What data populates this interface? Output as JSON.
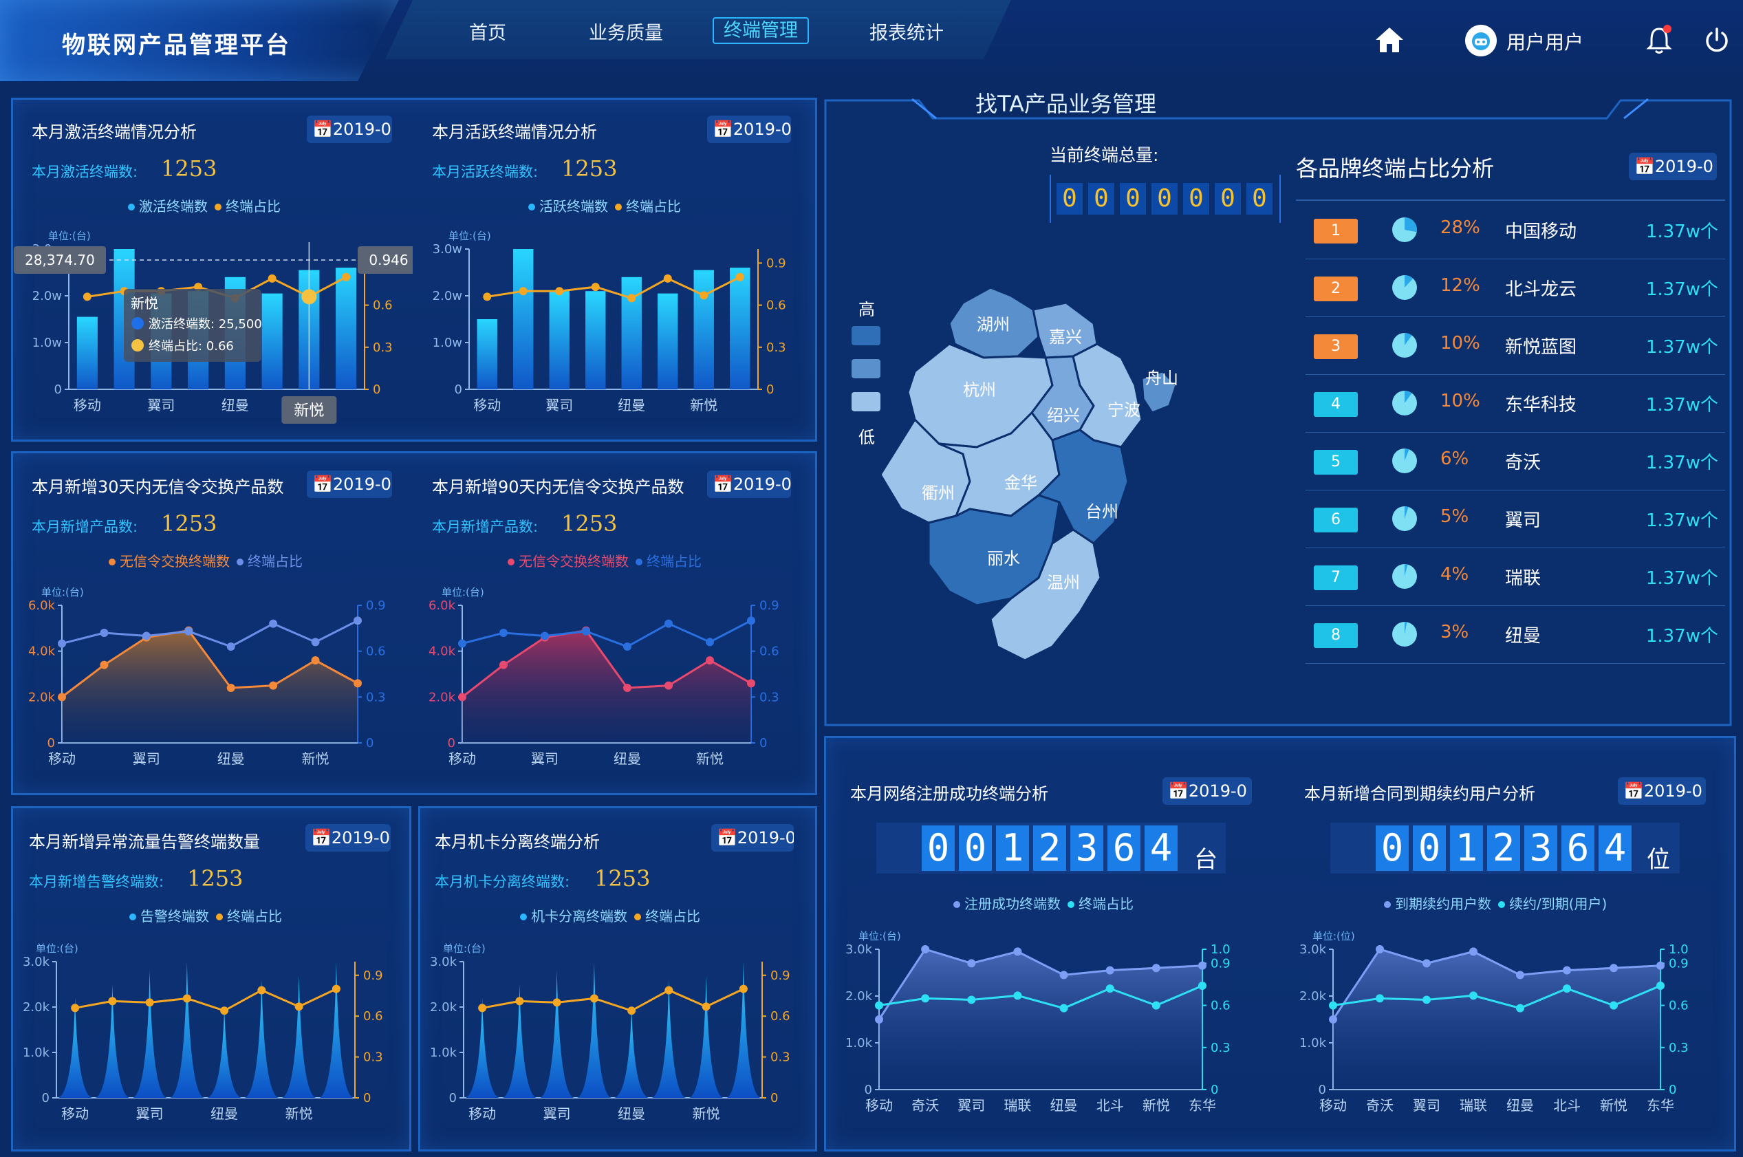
{
  "app": {
    "title": "物联网产品管理平台"
  },
  "nav": {
    "items": [
      "首页",
      "业务质量",
      "终端管理",
      "报表统计"
    ],
    "active": "终端管理"
  },
  "user": {
    "name": "用户用户"
  },
  "colors": {
    "bg": "#0a2a66",
    "panel": "#0c3276",
    "accent": "#2ab7ff",
    "orange": "#f5a623",
    "cyan": "#2ee0f4",
    "pink": "#e8496e"
  },
  "panel1": {
    "title": "本月激活终端情况分析",
    "date": "2019-0",
    "stat_label": "本月激活终端数:",
    "stat_value": "1253",
    "legend": [
      "激活终端数",
      "终端占比"
    ],
    "unit": "单位:(台)",
    "tooltip": {
      "name": "新悦",
      "bar_label": "激活终端数: 25,500",
      "line_label": "终端占比: 0.66",
      "left_value": "28,374.70",
      "right_value": "0.946",
      "axis_value": "新悦"
    }
  },
  "panel2": {
    "title": "本月活跃终端情况分析",
    "date": "2019-0",
    "stat_label": "本月活跃终端数:",
    "stat_value": "1253",
    "legend": [
      "活跃终端数",
      "终端占比"
    ],
    "unit": "单位:(台)"
  },
  "panel3": {
    "title": "本月新增30天内无信令交换产品数",
    "date": "2019-0",
    "stat_label": "本月新增产品数:",
    "stat_value": "1253",
    "legend": [
      "无信令交换终端数",
      "终端占比"
    ],
    "unit": "单位:(台)"
  },
  "panel4": {
    "title": "本月新增90天内无信令交换产品数",
    "date": "2019-0",
    "stat_label": "本月新增产品数:",
    "stat_value": "1253",
    "legend": [
      "无信令交换终端数",
      "终端占比"
    ],
    "unit": "单位:(台)"
  },
  "panel5": {
    "title": "本月新增异常流量告警终端数量",
    "date": "2019-0",
    "stat_label": "本月新增告警终端数:",
    "stat_value": "1253",
    "legend": [
      "告警终端数",
      "终端占比"
    ],
    "unit": "单位:(台)"
  },
  "panel6": {
    "title": "本月机卡分离终端分析",
    "date": "2019-0",
    "stat_label": "本月机卡分离终端数:",
    "stat_value": "1253",
    "legend": [
      "机卡分离终端数",
      "终端占比"
    ],
    "unit": "单位:(台)"
  },
  "center": {
    "title": "找TA产品业务管理",
    "total_label": "当前终端总量:",
    "total_digits": [
      "0",
      "0",
      "0",
      "0",
      "0",
      "0",
      "0"
    ],
    "map_legend": {
      "high": "高",
      "low": "低"
    },
    "cities": [
      "湖州",
      "嘉兴",
      "杭州",
      "舟山",
      "绍兴",
      "宁波",
      "衢州",
      "金华",
      "台州",
      "丽水",
      "温州"
    ]
  },
  "brand": {
    "title": "各品牌终端占比分析",
    "date": "2019-0",
    "rows": [
      {
        "rank": "1",
        "pct": "28%",
        "pct_value": 28,
        "name": "中国移动",
        "count": "1.37w个"
      },
      {
        "rank": "2",
        "pct": "12%",
        "pct_value": 12,
        "name": "北斗龙云",
        "count": "1.37w个"
      },
      {
        "rank": "3",
        "pct": "10%",
        "pct_value": 10,
        "name": "新悦蓝图",
        "count": "1.37w个"
      },
      {
        "rank": "4",
        "pct": "10%",
        "pct_value": 10,
        "name": "东华科技",
        "count": "1.37w个"
      },
      {
        "rank": "5",
        "pct": "6%",
        "pct_value": 6,
        "name": "奇沃",
        "count": "1.37w个"
      },
      {
        "rank": "6",
        "pct": "5%",
        "pct_value": 5,
        "name": "翼司",
        "count": "1.37w个"
      },
      {
        "rank": "7",
        "pct": "4%",
        "pct_value": 4,
        "name": "瑞联",
        "count": "1.37w个"
      },
      {
        "rank": "8",
        "pct": "3%",
        "pct_value": 3,
        "name": "纽曼",
        "count": "1.37w个"
      }
    ]
  },
  "panel7": {
    "title": "本月网络注册成功终端分析",
    "date": "2019-0",
    "digits": [
      "0",
      "0",
      "1",
      "2",
      "3",
      "6",
      "4"
    ],
    "digit_unit": "台",
    "legend": [
      "注册成功终端数",
      "终端占比"
    ],
    "unit": "单位:(台)"
  },
  "panel8": {
    "title": "本月新增合同到期续约用户分析",
    "date": "2019-0",
    "digits": [
      "0",
      "0",
      "1",
      "2",
      "3",
      "6",
      "4"
    ],
    "digit_unit": "位",
    "legend": [
      "到期续约用户数",
      "续约/到期(用户)"
    ],
    "unit": "单位:(位)"
  },
  "chart_data": [
    {
      "id": "c1",
      "type": "bar",
      "categories": [
        "移动",
        "",
        "翼司",
        "",
        "纽曼",
        "",
        "新悦",
        ""
      ],
      "series": [
        {
          "name": "激活终端数",
          "values": [
            15500,
            30000,
            20500,
            21000,
            24000,
            20500,
            25500,
            26000
          ]
        },
        {
          "name": "终端占比",
          "values": [
            0.66,
            0.7,
            0.7,
            0.73,
            0.65,
            0.79,
            0.66,
            0.8
          ]
        }
      ],
      "ylim": [
        0,
        30000
      ],
      "y2lim": [
        0,
        1.0
      ],
      "yticks": [
        "0",
        "1.0w",
        "2.0w",
        "3.0w"
      ],
      "y2ticks": [
        "0",
        "0.3",
        "0.6",
        "0.9"
      ]
    },
    {
      "id": "c2",
      "type": "bar",
      "categories": [
        "移动",
        "",
        "翼司",
        "",
        "纽曼",
        "",
        "新悦",
        ""
      ],
      "series": [
        {
          "name": "活跃终端数",
          "values": [
            15000,
            30000,
            21000,
            21000,
            24000,
            20500,
            25500,
            26000
          ]
        },
        {
          "name": "终端占比",
          "values": [
            0.66,
            0.7,
            0.7,
            0.73,
            0.65,
            0.79,
            0.67,
            0.8
          ]
        }
      ],
      "ylim": [
        0,
        30000
      ],
      "y2lim": [
        0,
        1.0
      ],
      "yticks": [
        "0",
        "1.0w",
        "2.0w",
        "3.0w"
      ],
      "y2ticks": [
        "0",
        "0.3",
        "0.6",
        "0.9"
      ]
    },
    {
      "id": "c3",
      "type": "area",
      "categories": [
        "移动",
        "",
        "翼司",
        "",
        "纽曼",
        "",
        "新悦",
        "",
        ""
      ],
      "series": [
        {
          "name": "无信令交换终端数",
          "values": [
            2000,
            3400,
            4600,
            4900,
            2400,
            2500,
            3600,
            2600
          ]
        },
        {
          "name": "终端占比",
          "values": [
            0.65,
            0.72,
            0.7,
            0.73,
            0.63,
            0.78,
            0.66,
            0.8
          ]
        }
      ],
      "ylim": [
        0,
        6000
      ],
      "y2lim": [
        0,
        0.9
      ],
      "yticks": [
        "0",
        "2.0k",
        "4.0k",
        "6.0k"
      ],
      "y2ticks": [
        "0",
        "0.3",
        "0.6",
        "0.9"
      ]
    },
    {
      "id": "c4",
      "type": "area",
      "categories": [
        "移动",
        "",
        "翼司",
        "",
        "纽曼",
        "",
        "新悦",
        "",
        ""
      ],
      "series": [
        {
          "name": "无信令交换终端数",
          "values": [
            2000,
            3400,
            4600,
            4900,
            2400,
            2500,
            3600,
            2600
          ]
        },
        {
          "name": "终端占比",
          "values": [
            0.65,
            0.72,
            0.7,
            0.73,
            0.63,
            0.78,
            0.66,
            0.8
          ]
        }
      ],
      "ylim": [
        0,
        6000
      ],
      "y2lim": [
        0,
        0.9
      ],
      "yticks": [
        "0",
        "2.0k",
        "4.0k",
        "6.0k"
      ],
      "y2ticks": [
        "0",
        "0.3",
        "0.6",
        "0.9"
      ]
    },
    {
      "id": "c5",
      "type": "bar",
      "categories": [
        "移动",
        "",
        "翼司",
        "",
        "纽曼",
        "",
        "新悦",
        ""
      ],
      "series": [
        {
          "name": "告警终端数",
          "values": [
            2200,
            2500,
            2800,
            3000,
            2000,
            2600,
            2700,
            3000
          ]
        },
        {
          "name": "终端占比",
          "values": [
            0.66,
            0.71,
            0.7,
            0.73,
            0.64,
            0.79,
            0.67,
            0.8
          ]
        }
      ],
      "ylim": [
        0,
        3000
      ],
      "y2lim": [
        0,
        1.0
      ],
      "yticks": [
        "0",
        "1.0k",
        "2.0k",
        "3.0k"
      ],
      "y2ticks": [
        "0",
        "0.3",
        "0.6",
        "0.9"
      ]
    },
    {
      "id": "c6",
      "type": "bar",
      "categories": [
        "移动",
        "",
        "翼司",
        "",
        "纽曼",
        "",
        "新悦",
        ""
      ],
      "series": [
        {
          "name": "机卡分离终端数",
          "values": [
            2200,
            2500,
            2800,
            3000,
            2000,
            2600,
            2700,
            3000
          ]
        },
        {
          "name": "终端占比",
          "values": [
            0.66,
            0.71,
            0.7,
            0.73,
            0.64,
            0.79,
            0.67,
            0.8
          ]
        }
      ],
      "ylim": [
        0,
        3000
      ],
      "y2lim": [
        0,
        1.0
      ],
      "yticks": [
        "0",
        "1.0k",
        "2.0k",
        "3.0k"
      ],
      "y2ticks": [
        "0",
        "0.3",
        "0.6",
        "0.9"
      ]
    },
    {
      "id": "c7",
      "type": "area",
      "categories": [
        "移动",
        "奇沃",
        "翼司",
        "瑞联",
        "纽曼",
        "北斗",
        "新悦",
        "东华"
      ],
      "series": [
        {
          "name": "注册成功终端数",
          "values": [
            1500,
            3000,
            2700,
            2950,
            2450,
            2550,
            2600,
            2650
          ]
        },
        {
          "name": "终端占比",
          "values": [
            0.6,
            0.65,
            0.64,
            0.67,
            0.58,
            0.72,
            0.6,
            0.74
          ]
        }
      ],
      "ylim": [
        0,
        3000
      ],
      "y2lim": [
        0,
        1.0
      ],
      "yticks": [
        "0",
        "1.0k",
        "2.0k",
        "3.0k"
      ],
      "y2ticks": [
        "0",
        "0.3",
        "0.6",
        "0.9",
        "1.0"
      ]
    },
    {
      "id": "c8",
      "type": "area",
      "categories": [
        "移动",
        "奇沃",
        "翼司",
        "瑞联",
        "纽曼",
        "北斗",
        "新悦",
        "东华"
      ],
      "series": [
        {
          "name": "到期续约用户数",
          "values": [
            1500,
            3000,
            2700,
            2950,
            2450,
            2550,
            2600,
            2650
          ]
        },
        {
          "name": "续约/到期(用户)",
          "values": [
            0.6,
            0.65,
            0.64,
            0.67,
            0.58,
            0.72,
            0.6,
            0.74
          ]
        }
      ],
      "ylim": [
        0,
        3000
      ],
      "y2lim": [
        0,
        1.0
      ],
      "yticks": [
        "0",
        "1.0k",
        "2.0k",
        "3.0k"
      ],
      "y2ticks": [
        "0",
        "0.3",
        "0.6",
        "0.9",
        "1.0"
      ]
    }
  ]
}
